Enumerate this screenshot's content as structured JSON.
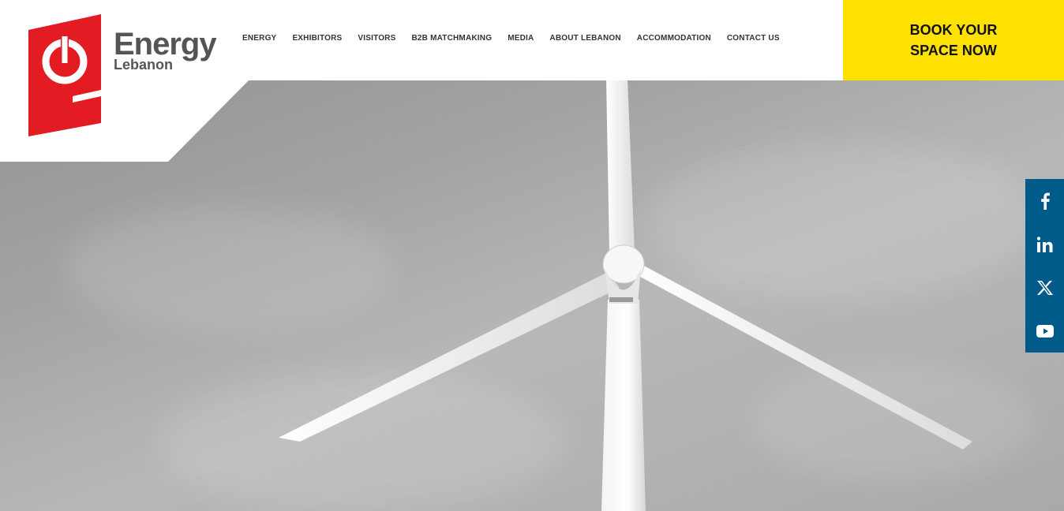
{
  "brand": {
    "name_line1": "Energy",
    "name_line2": "Lebanon",
    "logo_color": "#e31b23"
  },
  "nav": {
    "items": [
      "ENERGY",
      "EXHIBITORS",
      "VISITORS",
      "B2B MATCHMAKING",
      "MEDIA",
      "ABOUT LEBANON",
      "ACCOMMODATION",
      "CONTACT US"
    ]
  },
  "cta": {
    "line1": "BOOK YOUR",
    "line2": "SPACE NOW",
    "color": "#ffe100"
  },
  "social": {
    "color": "#005b8a",
    "icons": [
      "facebook-icon",
      "linkedin-icon",
      "x-icon",
      "youtube-icon"
    ]
  },
  "hero": {
    "image": "wind-turbine-photo-grayscale"
  }
}
